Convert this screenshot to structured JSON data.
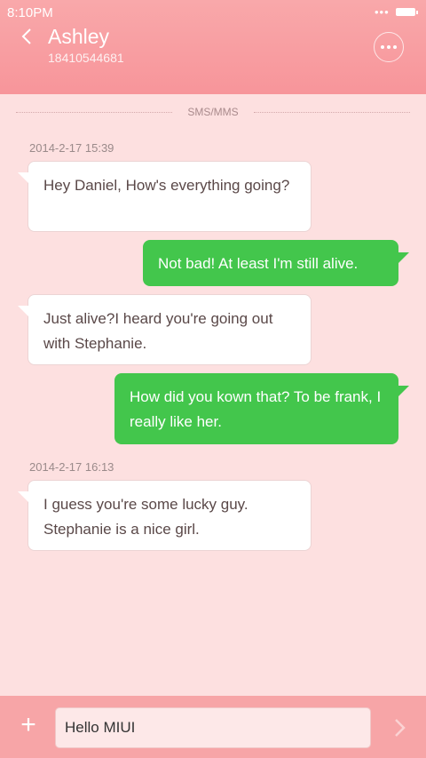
{
  "status": {
    "time": "8:10PM",
    "dots": "•••"
  },
  "header": {
    "name": "Ashley",
    "number": "18410544681"
  },
  "separator": {
    "label": "SMS/MMS"
  },
  "messages": [
    {
      "type": "timestamp",
      "text": "2014-2-17 15:39"
    },
    {
      "type": "incoming",
      "text": "Hey Daniel, How's everything going?"
    },
    {
      "type": "outgoing",
      "text": "Not bad! At least I'm still alive."
    },
    {
      "type": "incoming",
      "text": "Just  alive?I heard you're going out with Stephanie."
    },
    {
      "type": "outgoing",
      "text": "How did you kown that? To be frank, I really like her."
    },
    {
      "type": "timestamp",
      "text": "2014-2-17 16:13"
    },
    {
      "type": "incoming",
      "text": "I guess you're some lucky guy. Stephanie is a nice girl."
    }
  ],
  "composer": {
    "plus": "+",
    "value": "Hello MIUI"
  },
  "colors": {
    "header": "#f7959a",
    "background": "#fde0e0",
    "outgoing_bubble": "#43c64c",
    "incoming_bubble": "#ffffff"
  }
}
